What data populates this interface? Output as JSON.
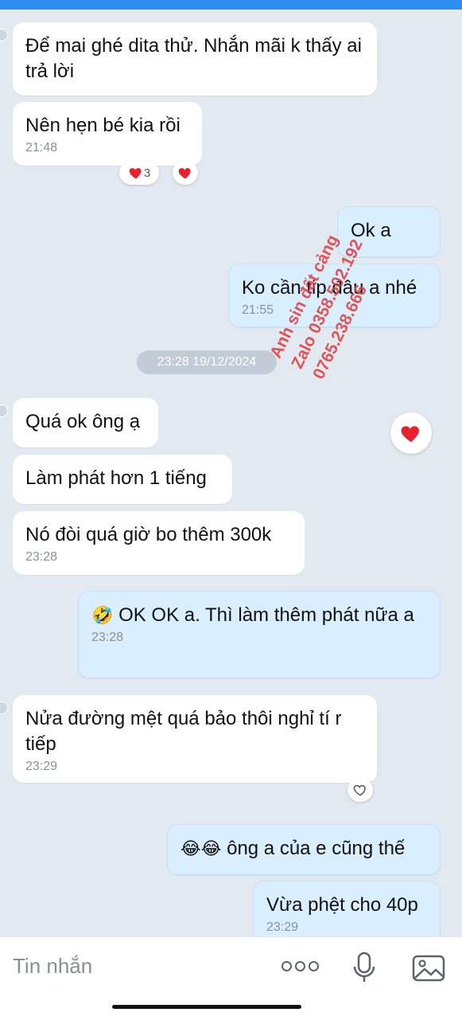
{
  "chat": {
    "messages": [
      {
        "text": "Để mai ghé dita thử. Nhắn mãi k thấy ai trả lời",
        "time": ""
      },
      {
        "text": "Nên hẹn bé kia rồi",
        "time": "21:48"
      },
      {
        "text": "Ok a",
        "time": ""
      },
      {
        "text": "Ko cần tip đâu a nhé",
        "time": "21:55"
      },
      {
        "text": "Quá ok ông ạ",
        "time": ""
      },
      {
        "text": "Làm phát hơn 1 tiếng",
        "time": ""
      },
      {
        "text": "Nó đòi quá giờ bo thêm 300k",
        "time": "23:28"
      },
      {
        "emoji": "🤣",
        "text": "OK OK a.  Thì làm thêm phát nữa a",
        "time": "23:28"
      },
      {
        "text": "Nửa đường mệt quá bảo thôi nghỉ tí r tiếp",
        "time": "23:29"
      },
      {
        "emoji": "😂😂",
        "text": "ông a của e cũng thế",
        "time": ""
      },
      {
        "text": "Vừa phệt cho 40p",
        "time": "23:29"
      }
    ],
    "date_separator": "23:28 19/12/2024",
    "reaction_count": "3"
  },
  "watermark": {
    "line1": "Anh sin đất cảng",
    "line2": "Zalo 0358.502.192",
    "line3": "0765.238.666"
  },
  "input": {
    "placeholder": "Tin nhắn"
  },
  "icons": {
    "heart": "heart-icon",
    "more": "more-dots-icon",
    "mic": "microphone-icon",
    "image": "image-icon"
  },
  "colors": {
    "outgoing": "#d9eefe",
    "incoming": "#ffffff",
    "background": "#e2e9f1",
    "heart": "#e8202e",
    "watermark": "#e23a3a"
  }
}
